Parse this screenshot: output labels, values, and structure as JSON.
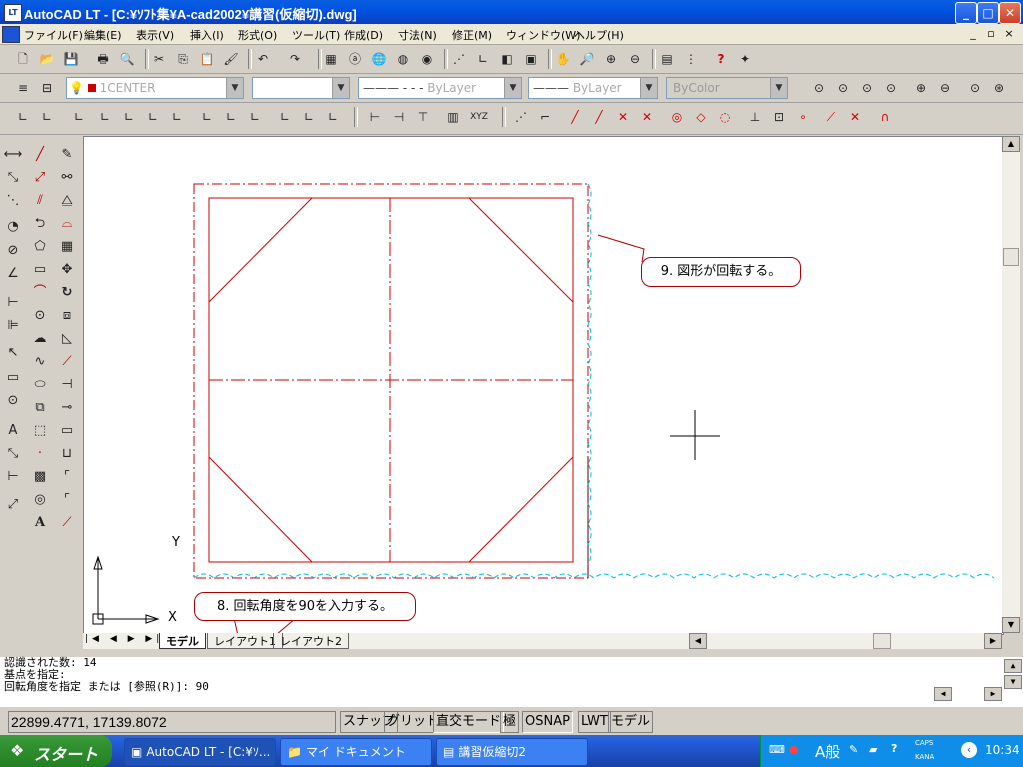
{
  "window": {
    "title": "AutoCAD LT - [C:¥ｿﾌﾄ集¥A-cad2002¥講習(仮縮切).dwg]",
    "minimize_label": "_",
    "maximize_label": "□",
    "close_label": "✕"
  },
  "menu": {
    "items": [
      "ファイル(F)",
      "編集(E)",
      "表示(V)",
      "挿入(I)",
      "形式(O)",
      "ツール(T)",
      "作成(D)",
      "寸法(N)",
      "修正(M)",
      "ウィンドウ(W)",
      "ヘルプ(H)"
    ],
    "mdi_controls": [
      "_",
      "▫",
      "×"
    ]
  },
  "layer_toolbar": {
    "layer_name": "1CENTER",
    "linetype": "ByLayer",
    "lineweight": "ByLayer",
    "color": "ByColor"
  },
  "canvas": {
    "ucs_x_label": "X",
    "ucs_y_label": "Y",
    "callout_top": "9. 図形が回転する。",
    "callout_bottom": "8. 回転角度を90を入力する。"
  },
  "layout_tabs": [
    "モデル",
    "レイアウト1",
    "レイアウト2"
  ],
  "command_lines": [
    "認識された数: 14",
    "基点を指定:",
    "回転角度を指定 または [参照(R)]: 90"
  ],
  "status": {
    "coordinates": "22899.4771, 17139.8072",
    "toggles": [
      "スナップ",
      "グリッド",
      "直交モード",
      "極",
      "OSNAP",
      "LWT",
      "モデル"
    ]
  },
  "taskbar": {
    "start_label": "スタート",
    "tasks": [
      "AutoCAD LT - [C:¥ｿ...",
      "マイ ドキュメント",
      "講習仮縮切2"
    ],
    "ime_label": "A般",
    "caps_label": "CAPS",
    "kana_label": "KANA",
    "clock": "10:34"
  }
}
